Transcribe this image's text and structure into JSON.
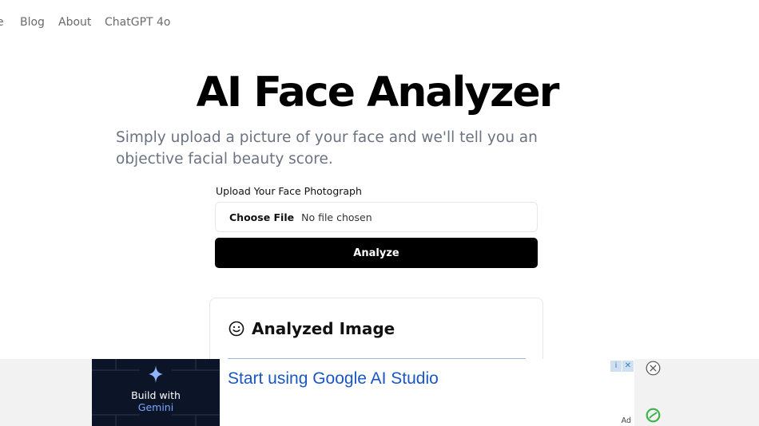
{
  "nav": {
    "items": [
      {
        "label": "e"
      },
      {
        "label": "Blog"
      },
      {
        "label": "About"
      },
      {
        "label": "ChatGPT 4o"
      }
    ]
  },
  "hero": {
    "title": "AI Face Analyzer",
    "subtitle": "Simply upload a picture of your face and we'll tell you an objective facial beauty score."
  },
  "upload": {
    "label": "Upload Your Face Photograph",
    "choose_file": "Choose File",
    "file_status": "No file chosen",
    "analyze_label": "Analyze"
  },
  "result_card": {
    "title": "Analyzed Image",
    "icon": "smile-icon"
  },
  "ad": {
    "image_line1": "Build with",
    "image_line2": "Gemini",
    "headline": "Start using Google AI Studio",
    "choices_info": "i",
    "choices_close": "✕",
    "label": "Ad",
    "colors": {
      "headline": "#1a56c4",
      "image_bg": "#0c1528",
      "gemini": "#7aa7ff",
      "brand_icon": "#3db34a"
    }
  }
}
